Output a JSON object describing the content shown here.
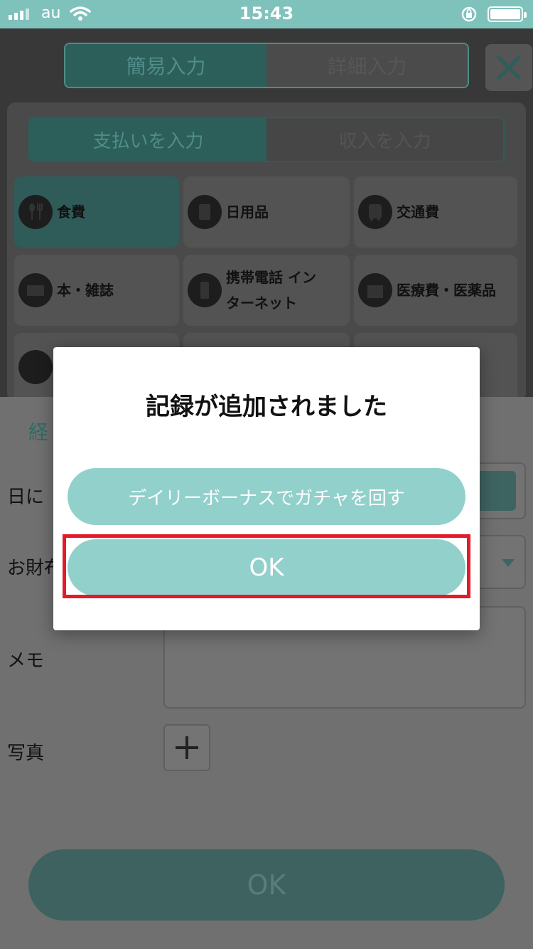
{
  "status_bar": {
    "carrier": "au",
    "time": "15:43"
  },
  "mode_tabs": [
    {
      "label": "簡易入力",
      "active": true
    },
    {
      "label": "詳細入力",
      "active": false
    }
  ],
  "type_tabs": [
    {
      "label": "支払いを入力",
      "active": true
    },
    {
      "label": "収入を入力",
      "active": false
    }
  ],
  "categories": [
    {
      "label": "食費",
      "icon": "fork-spoon-icon",
      "selected": true
    },
    {
      "label": "日用品",
      "icon": "notebook-icon",
      "selected": false
    },
    {
      "label": "交通費",
      "icon": "bus-icon",
      "selected": false
    },
    {
      "label": "本・雑誌",
      "icon": "book-icon",
      "selected": false
    },
    {
      "label_line1": "携帯電話 イン",
      "label_line2": "ターネット",
      "icon": "smartphone-icon",
      "selected": false
    },
    {
      "label": "医療費・医薬品",
      "icon": "hospital-icon",
      "selected": false
    }
  ],
  "form": {
    "section_label_partial": "経",
    "date_label_partial": "日に",
    "wallet_label_partial": "お財布",
    "memo_label": "メモ",
    "photo_label": "写真",
    "ok_label": "OK"
  },
  "dialog": {
    "title": "記録が追加されました",
    "gacha_button": "デイリーボーナスでガチャを回す",
    "ok_button": "OK"
  },
  "colors": {
    "status_bar": "#7fc2bc",
    "dialog_button": "#92d0cc",
    "highlight": "#e21b2b"
  }
}
